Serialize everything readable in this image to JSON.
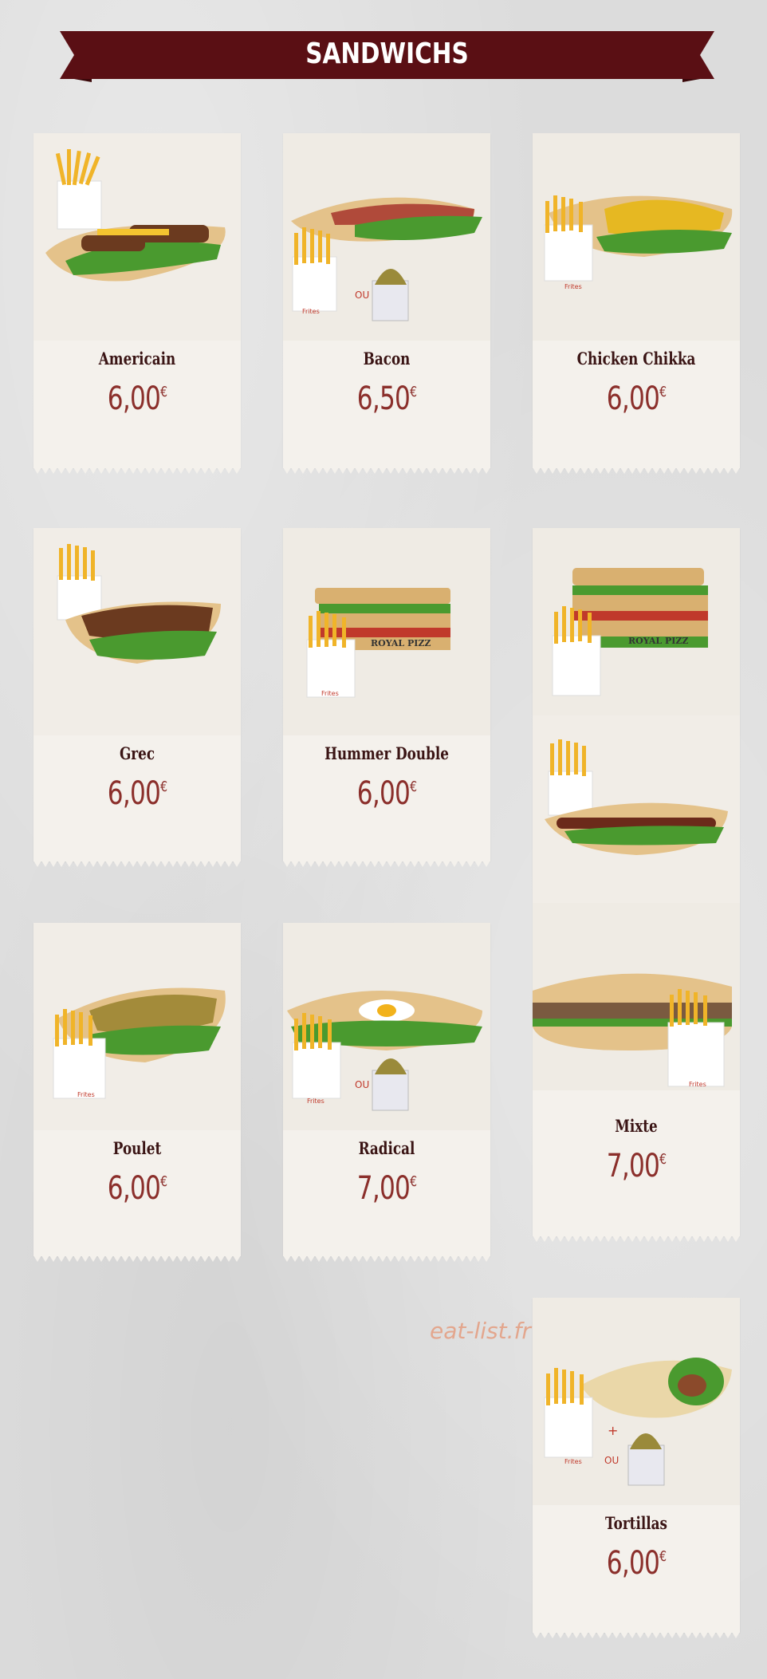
{
  "header": {
    "title": "SANDWICHS"
  },
  "items": [
    {
      "name": "Americain",
      "price": "6,00",
      "currency": "€"
    },
    {
      "name": "Bacon",
      "price": "6,50",
      "currency": "€"
    },
    {
      "name": "Chicken Chikka",
      "price": "6,00",
      "currency": "€"
    },
    {
      "name": "Grec",
      "price": "6,00",
      "currency": "€"
    },
    {
      "name": "Hummer Double",
      "price": "6,00",
      "currency": "€"
    },
    {
      "name": "Mixte",
      "price": "7,00",
      "currency": "€"
    },
    {
      "name": "Poulet",
      "price": "6,00",
      "currency": "€"
    },
    {
      "name": "Radical",
      "price": "7,00",
      "currency": "€"
    },
    {
      "name": "Tortillas",
      "price": "6,00",
      "currency": "€"
    }
  ],
  "photo_labels": {
    "fries": "Frites",
    "or": "OU",
    "plus": "+",
    "brand": "ROYAL PIZZ"
  },
  "watermark": "eat-list.fr",
  "colors": {
    "banner": "#5a0f14",
    "price": "#8b2f2b",
    "name": "#3a1414",
    "watermark": "#e3a68d",
    "card": "#f4f1ec"
  }
}
